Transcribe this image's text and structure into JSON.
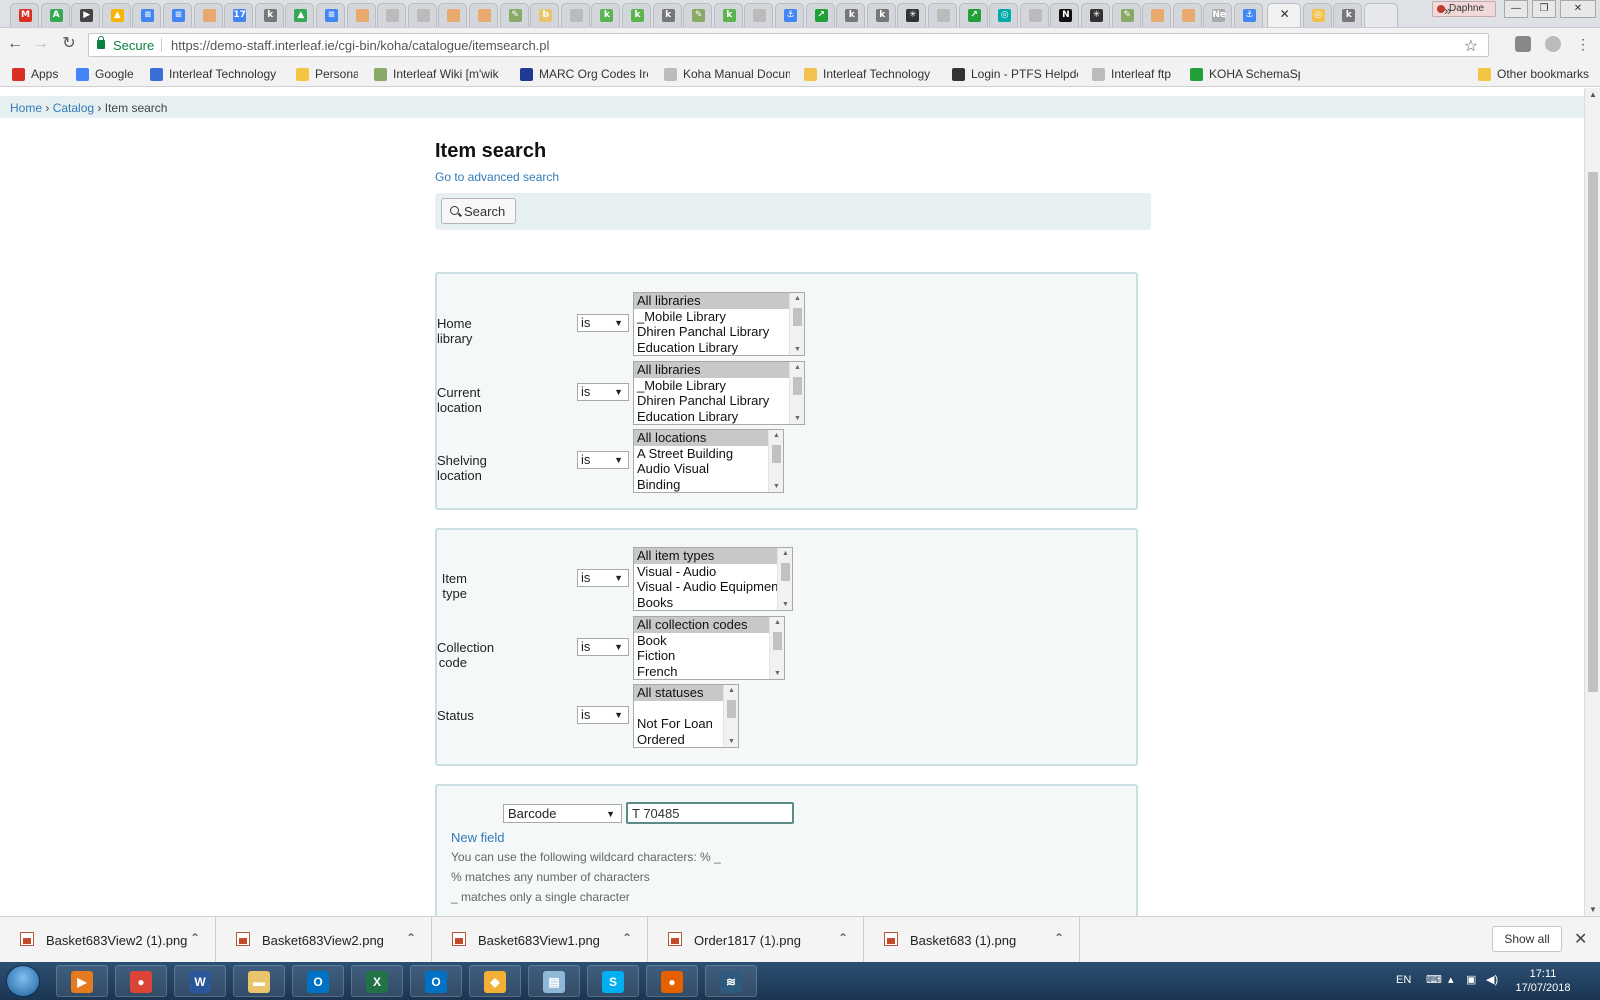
{
  "browser": {
    "tabs": [
      {
        "letter": "M",
        "color": "#d93025"
      },
      {
        "letter": "A",
        "color": "#34a853"
      },
      {
        "letter": "▶",
        "color": "#444"
      },
      {
        "letter": "▲",
        "color": "#f4b400"
      },
      {
        "letter": "≡",
        "color": "#4285f4"
      },
      {
        "letter": "≡",
        "color": "#4285f4"
      },
      {
        "letter": "",
        "color": "#e7a96e"
      },
      {
        "letter": "17",
        "color": "#4285f4"
      },
      {
        "letter": "k",
        "color": "#777"
      },
      {
        "letter": "▲",
        "color": "#34a853"
      },
      {
        "letter": "≡",
        "color": "#4285f4"
      },
      {
        "letter": "",
        "color": "#e7a96e"
      },
      {
        "letter": "",
        "color": "#bbb"
      },
      {
        "letter": "",
        "color": "#bbb"
      },
      {
        "letter": "",
        "color": "#e7a96e"
      },
      {
        "letter": "",
        "color": "#e7a96e"
      },
      {
        "letter": "✎",
        "color": "#8a6"
      },
      {
        "letter": "b",
        "color": "#e9c46a"
      },
      {
        "letter": "",
        "color": "#bbb"
      },
      {
        "letter": "k",
        "color": "#5bb450"
      },
      {
        "letter": "k",
        "color": "#5bb450"
      },
      {
        "letter": "k",
        "color": "#777"
      },
      {
        "letter": "✎",
        "color": "#8a6"
      },
      {
        "letter": "k",
        "color": "#5bb450"
      },
      {
        "letter": "",
        "color": "#bbb"
      },
      {
        "letter": "⚓",
        "color": "#4285f4"
      },
      {
        "letter": "↗",
        "color": "#21a038"
      },
      {
        "letter": "k",
        "color": "#777"
      },
      {
        "letter": "k",
        "color": "#777"
      },
      {
        "letter": "✳",
        "color": "#333"
      },
      {
        "letter": "",
        "color": "#bbb"
      },
      {
        "letter": "↗",
        "color": "#21a038"
      },
      {
        "letter": "◎",
        "color": "#0aa"
      },
      {
        "letter": "",
        "color": "#bbb"
      },
      {
        "letter": "N",
        "color": "#111"
      },
      {
        "letter": "✳",
        "color": "#333"
      },
      {
        "letter": "✎",
        "color": "#8a6"
      },
      {
        "letter": "",
        "color": "#e7a96e"
      },
      {
        "letter": "",
        "color": "#e7a96e"
      },
      {
        "letter": "Ne",
        "color": "#aaa"
      },
      {
        "letter": "⚓",
        "color": "#4285f4"
      }
    ],
    "tabs_after_active": [
      {
        "letter": "◎",
        "color": "#f2c14e"
      },
      {
        "letter": "k",
        "color": "#777"
      }
    ],
    "active_tab_close": "✕",
    "profile": "Daphne",
    "window_controls": [
      "—",
      "❐",
      "✕"
    ],
    "secure_label": "Secure",
    "url": "https://demo-staff.interleaf.ie/cgi-bin/koha/catalogue/itemsearch.pl",
    "bookmarks": [
      {
        "label": "Apps",
        "color": "#d93025"
      },
      {
        "label": "Google",
        "color": "#4285f4"
      },
      {
        "label": "Interleaf Technology",
        "color": "#3a6fd8"
      },
      {
        "label": "Personal",
        "color": "#f4c542"
      },
      {
        "label": "Interleaf Wiki [m'wik",
        "color": "#8a6"
      },
      {
        "label": "MARC Org Codes Ire",
        "color": "#1f3a93"
      },
      {
        "label": "Koha Manual Docum",
        "color": "#bbb"
      },
      {
        "label": "Interleaf Technology",
        "color": "#f2c14e"
      },
      {
        "label": "Login - PTFS Helpde",
        "color": "#333"
      },
      {
        "label": "Interleaf ftp",
        "color": "#bbb"
      },
      {
        "label": "KOHA SchemaSpy",
        "color": "#21a038"
      }
    ],
    "bookmarks_more": "»",
    "other_bookmarks": "Other bookmarks"
  },
  "breadcrumb": {
    "home": "Home",
    "catalog": "Catalog",
    "current": "Item search",
    "sep": "›"
  },
  "page": {
    "title": "Item search",
    "advanced_link": "Go to advanced search",
    "search_button": "Search"
  },
  "filters": [
    {
      "label": "Home library",
      "op": "is",
      "options": [
        "All libraries",
        "_Mobile Library",
        "Dhiren Panchal Library",
        "Education Library"
      ]
    },
    {
      "label": "Current location",
      "op": "is",
      "options": [
        "All libraries",
        "_Mobile Library",
        "Dhiren Panchal Library",
        "Education Library"
      ]
    },
    {
      "label": "Shelving location",
      "op": "is",
      "options": [
        "All locations",
        "A Street Building",
        "Audio Visual",
        "Binding"
      ]
    },
    {
      "label": "Item type",
      "op": "is",
      "options": [
        "All item types",
        "Visual - Audio",
        "Visual - Audio Equipment",
        "Books"
      ]
    },
    {
      "label": "Collection code",
      "op": "is",
      "options": [
        "All collection codes",
        "Book",
        "Fiction",
        "French"
      ]
    },
    {
      "label": "Status",
      "op": "is",
      "options": [
        "All statuses",
        "",
        "Not For Loan",
        "Ordered"
      ]
    }
  ],
  "field_search": {
    "field": "Barcode",
    "value": "T 70485",
    "new_field": "New field",
    "hint1": "You can use the following wildcard characters: % _",
    "hint2": "% matches any number of characters",
    "hint3": "_ matches only a single character"
  },
  "downloads": {
    "files": [
      "Basket683View2 (1).png",
      "Basket683View2.png",
      "Basket683View1.png",
      "Order1817 (1).png",
      "Basket683 (1).png"
    ],
    "show_all": "Show all",
    "close": "✕"
  },
  "taskbar": {
    "apps": [
      {
        "name": "media-player",
        "glyph": "▶",
        "color": "#e57a1f"
      },
      {
        "name": "chrome",
        "glyph": "●",
        "color": "#db4437"
      },
      {
        "name": "word",
        "glyph": "W",
        "color": "#2b579a"
      },
      {
        "name": "explorer",
        "glyph": "▬",
        "color": "#e9c46a"
      },
      {
        "name": "outlook",
        "glyph": "O",
        "color": "#0072c6"
      },
      {
        "name": "excel",
        "glyph": "X",
        "color": "#217346"
      },
      {
        "name": "outlook-2",
        "glyph": "O",
        "color": "#0072c6"
      },
      {
        "name": "sharepoint",
        "glyph": "◆",
        "color": "#f2b134"
      },
      {
        "name": "notepad",
        "glyph": "▤",
        "color": "#8fb8d8"
      },
      {
        "name": "skype",
        "glyph": "S",
        "color": "#00aff0"
      },
      {
        "name": "firefox",
        "glyph": "●",
        "color": "#e66000"
      },
      {
        "name": "mysql",
        "glyph": "≋",
        "color": "#2e5a80"
      }
    ],
    "language": "EN",
    "time": "17:11",
    "date": "17/07/2018"
  }
}
